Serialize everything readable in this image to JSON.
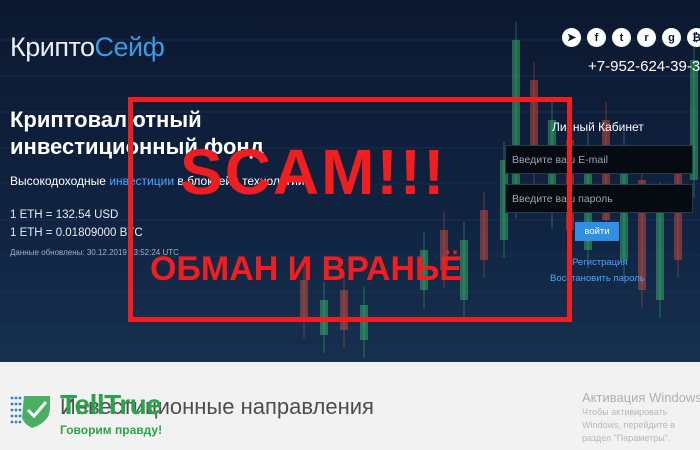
{
  "logo": {
    "part1": "Крипто",
    "part2": "Сейф"
  },
  "header": {
    "socials": [
      {
        "icon": "telegram-icon",
        "glyph": "➤"
      },
      {
        "icon": "facebook-icon",
        "glyph": "f"
      },
      {
        "icon": "twitter-icon",
        "glyph": "t"
      },
      {
        "icon": "reddit-icon",
        "glyph": "r"
      },
      {
        "icon": "github-icon",
        "glyph": "g"
      },
      {
        "icon": "bitcoin-icon",
        "glyph": "₿"
      }
    ],
    "phone": "+7-952-624-39-3"
  },
  "hero": {
    "title": "Криптовалютный инвестиционный фонд",
    "subtitle_before": "Высокодоходные ",
    "subtitle_link": "инвестиции",
    "subtitle_after": " в блокчейн технологии.",
    "rate1": "1 ETH   = 132.54 USD",
    "rate2": "1 ETH   = 0.01809000 BTC",
    "updated": "Данные обновлены: 30.12.2019 13:52:24 UTC"
  },
  "cabinet": {
    "title": "Личный Кабинет",
    "email_placeholder": "Введите ваш E-mail",
    "password_placeholder": "Введите ваш пароль",
    "login_label": "войти",
    "register_link": "Регистрация",
    "restore_link": "Восстановить пароль"
  },
  "overlay": {
    "scam": "SCAM!!!",
    "obman": "ОБМАН И ВРАНЬЁ"
  },
  "lower": {
    "section_title": "Инвестиционные направления",
    "tt_name": "TellTrue",
    "tt_slogan": "Говорим правду!"
  },
  "windows": {
    "activation_title": "Активация Windows",
    "activation_text": "Чтобы активировать Windows, перейдите в раздел \"Параметры\"."
  },
  "colors": {
    "accent_blue": "#3a9be8",
    "scam_red": "#f01e1e",
    "telltrue_green": "#2aa34a"
  }
}
